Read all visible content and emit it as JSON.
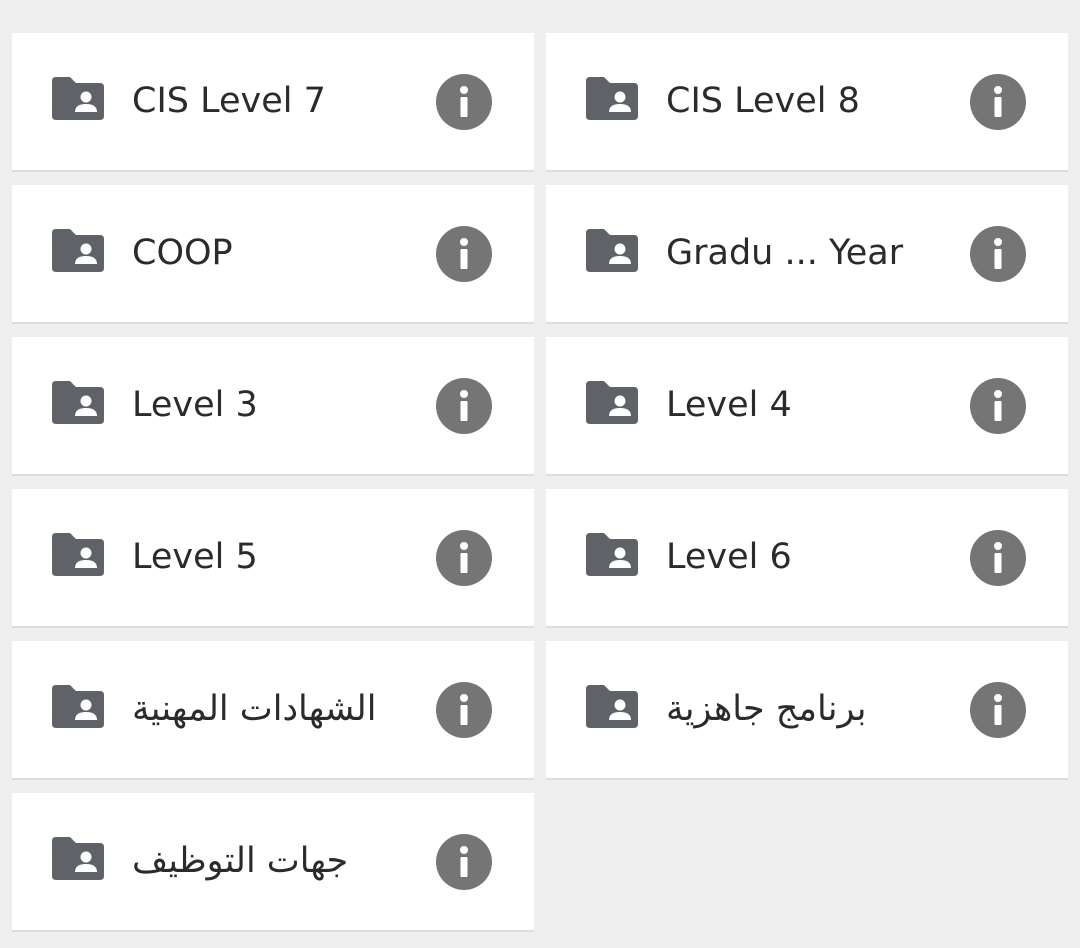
{
  "folders": [
    {
      "label": "CIS Level 7",
      "rtl": false
    },
    {
      "label": "CIS Level 8",
      "rtl": false
    },
    {
      "label": "COOP",
      "rtl": false
    },
    {
      "label": "Gradu ... Year",
      "rtl": false
    },
    {
      "label": "Level 3",
      "rtl": false
    },
    {
      "label": "Level 4",
      "rtl": false
    },
    {
      "label": "Level 5",
      "rtl": false
    },
    {
      "label": "Level 6",
      "rtl": false
    },
    {
      "label": "الشهادات المهنية",
      "rtl": true
    },
    {
      "label": "برنامج جاهزية",
      "rtl": true
    },
    {
      "label": "جهات التوظيف",
      "rtl": true
    }
  ],
  "icons": {
    "folder": "shared-folder-icon",
    "info": "info-icon"
  },
  "colors": {
    "background": "#eeeeee",
    "card": "#ffffff",
    "folder_icon": "#5f6368",
    "info_icon": "#757575",
    "text": "#2b2b2b"
  }
}
